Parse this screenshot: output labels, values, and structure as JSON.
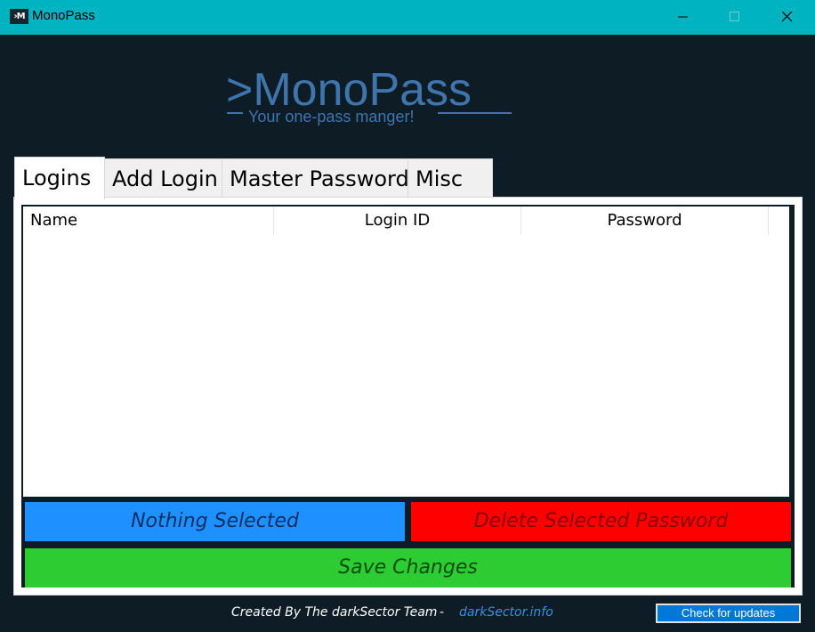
{
  "window": {
    "icon_text": "›M",
    "title": "MonoPass"
  },
  "logo": {
    "title": ">MonoPass",
    "subtitle": "Your one-pass manger!"
  },
  "tabs": [
    {
      "label": "Logins",
      "active": true
    },
    {
      "label": "Add Login",
      "active": false
    },
    {
      "label": "Master Password",
      "active": false
    },
    {
      "label": "Misc",
      "active": false
    }
  ],
  "list": {
    "columns": [
      "Name",
      "Login ID",
      "Password"
    ],
    "rows": []
  },
  "buttons": {
    "selection_label": "Nothing Selected",
    "delete_label": "Delete Selected Password",
    "save_label": "Save Changes"
  },
  "footer": {
    "credit": "Created By The darkSector Team",
    "separator": "-",
    "link": "darkSector.info",
    "update_label": "Check for updates"
  },
  "colors": {
    "titlebar": "#00b3c0",
    "background": "#0e1d25",
    "logo": "#3f74ad",
    "selection_button": "#1e90ff",
    "delete_button": "#ff0000",
    "save_button": "#2ecc33",
    "link": "#3a8ee6"
  }
}
